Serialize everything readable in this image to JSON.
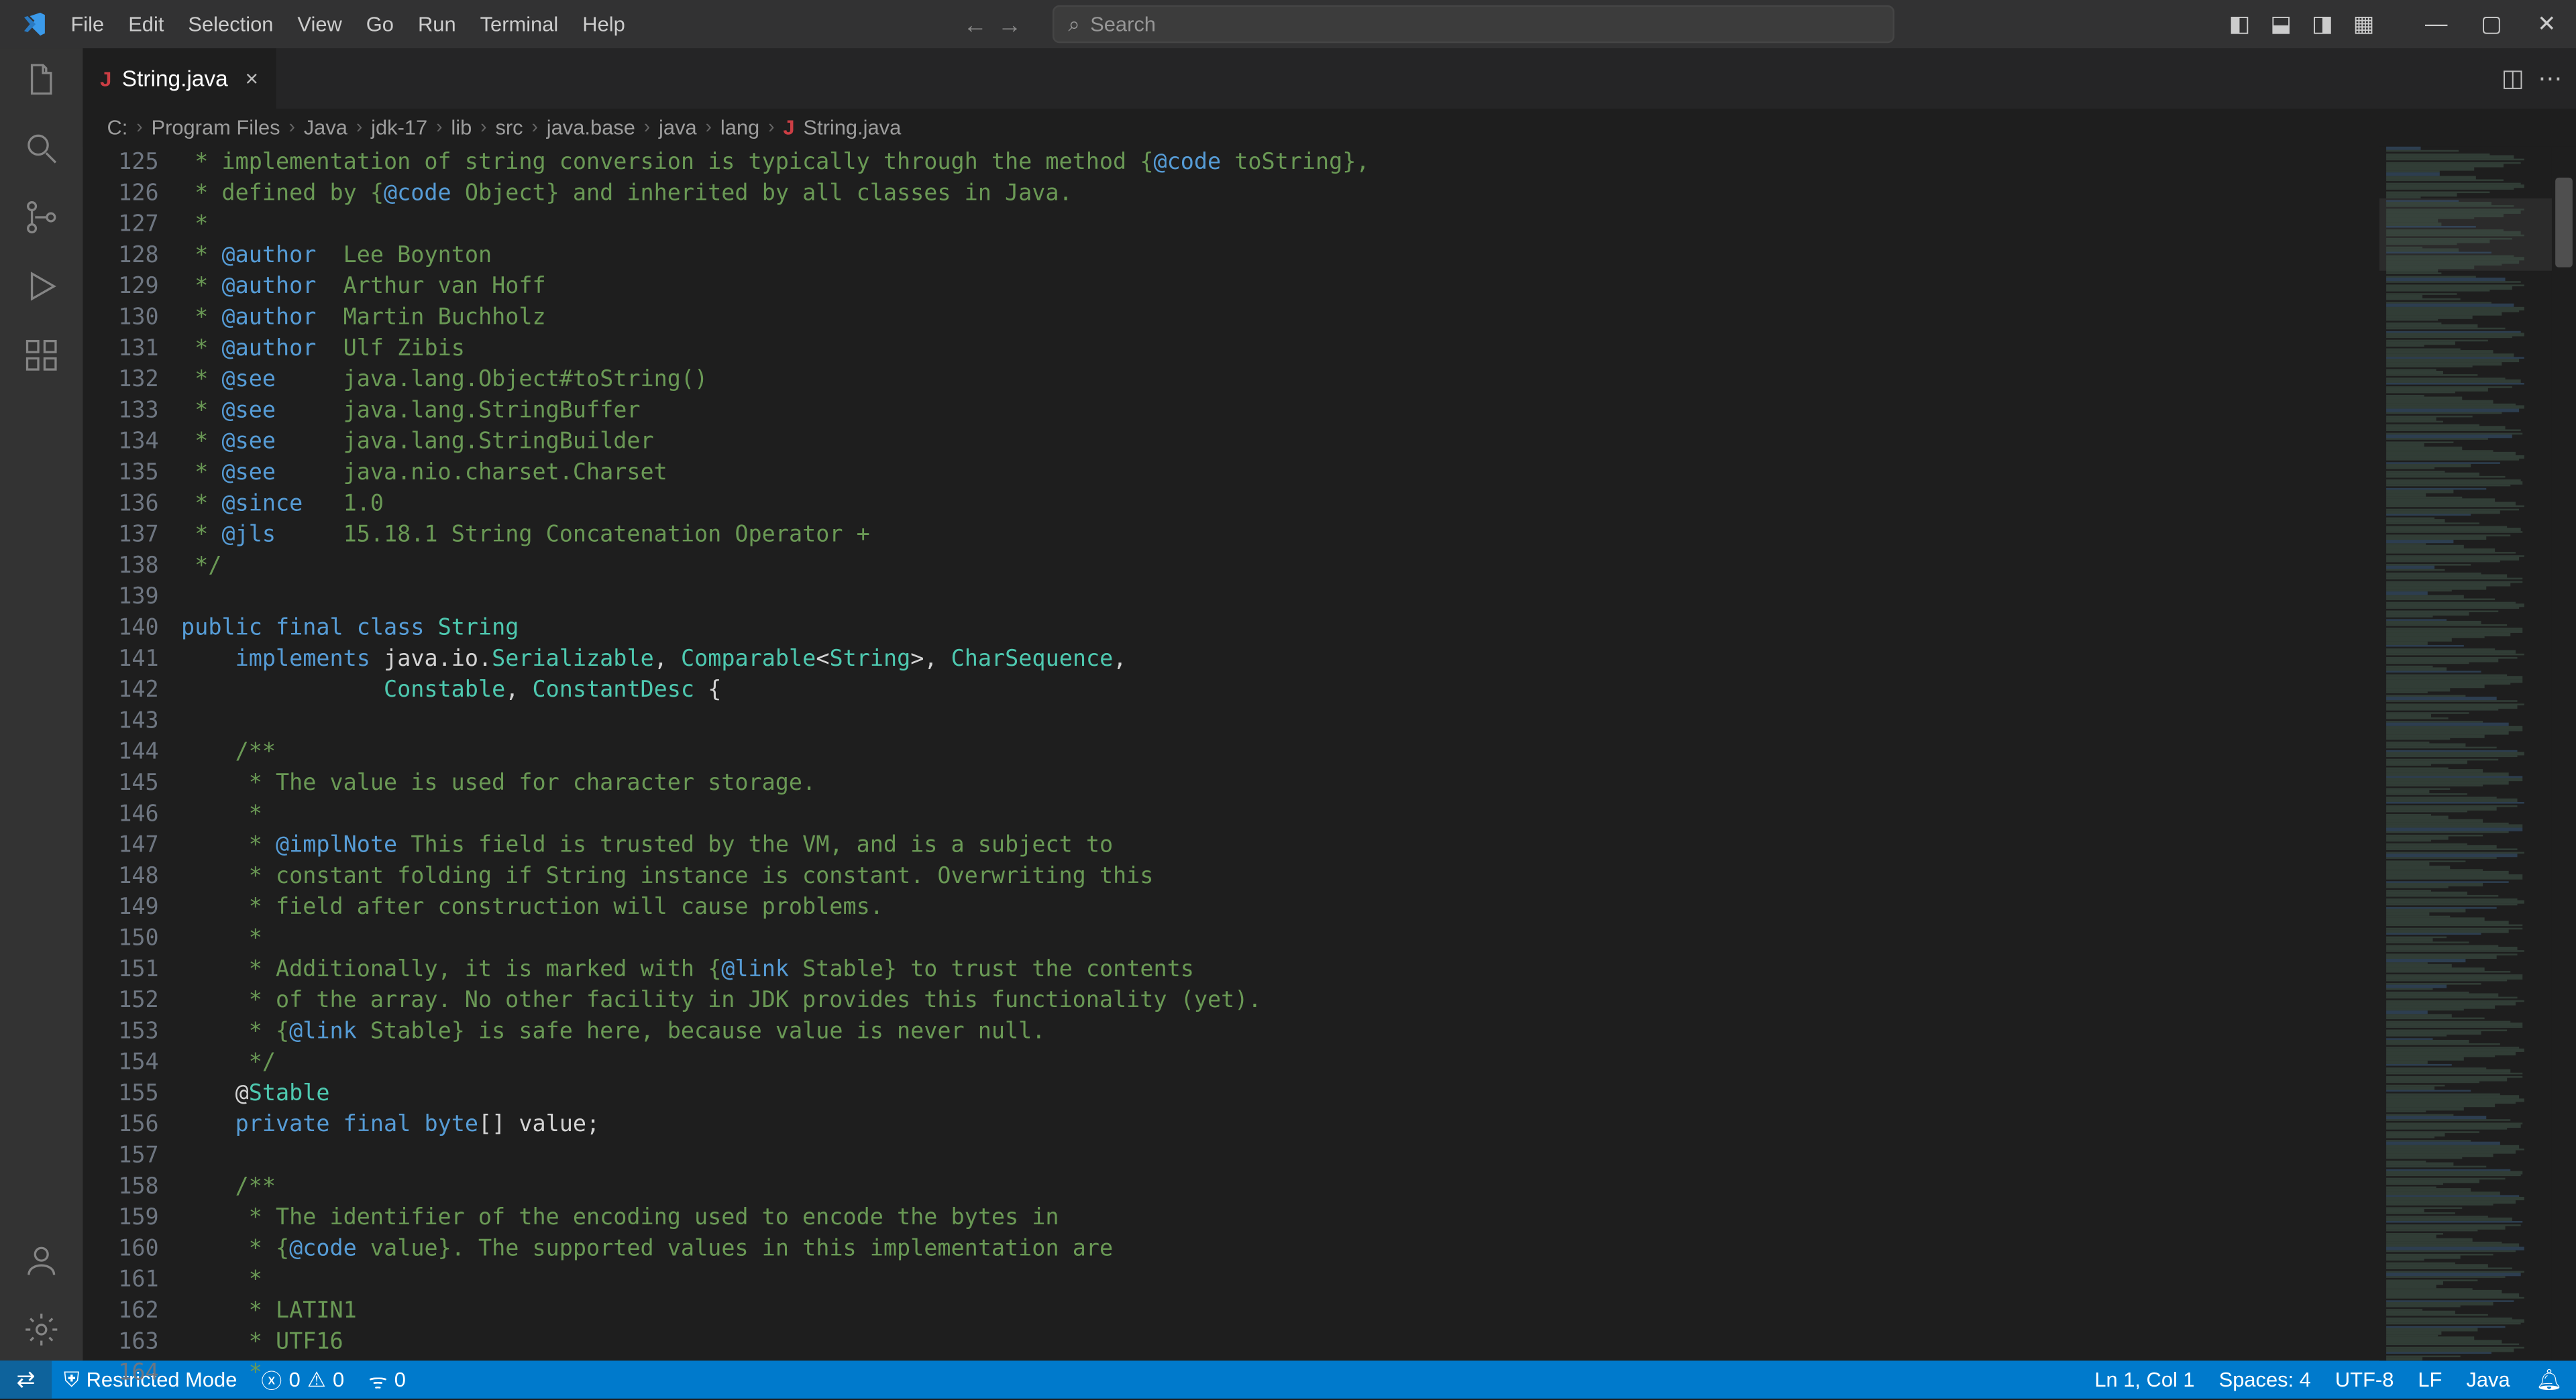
{
  "menubar": [
    "File",
    "Edit",
    "Selection",
    "View",
    "Go",
    "Run",
    "Terminal",
    "Help"
  ],
  "search_placeholder": "Search",
  "tab": {
    "name": "String.java"
  },
  "breadcrumb": [
    "C:",
    "Program Files",
    "Java",
    "jdk-17",
    "lib",
    "src",
    "java.base",
    "java",
    "lang"
  ],
  "breadcrumb_file": "String.java",
  "line_start": 125,
  "lines": [
    " * implementation of string conversion is typically through the method {@code toString},",
    " * defined by {@code Object} and inherited by all classes in Java.",
    " *",
    " * @author  Lee Boynton",
    " * @author  Arthur van Hoff",
    " * @author  Martin Buchholz",
    " * @author  Ulf Zibis",
    " * @see     java.lang.Object#toString()",
    " * @see     java.lang.StringBuffer",
    " * @see     java.lang.StringBuilder",
    " * @see     java.nio.charset.Charset",
    " * @since   1.0",
    " * @jls     15.18.1 String Concatenation Operator +",
    " */",
    "",
    "public final class String",
    "    implements java.io.Serializable, Comparable<String>, CharSequence,",
    "               Constable, ConstantDesc {",
    "",
    "    /**",
    "     * The value is used for character storage.",
    "     *",
    "     * @implNote This field is trusted by the VM, and is a subject to",
    "     * constant folding if String instance is constant. Overwriting this",
    "     * field after construction will cause problems.",
    "     *",
    "     * Additionally, it is marked with {@link Stable} to trust the contents",
    "     * of the array. No other facility in JDK provides this functionality (yet).",
    "     * {@link Stable} is safe here, because value is never null.",
    "     */",
    "    @Stable",
    "    private final byte[] value;",
    "",
    "    /**",
    "     * The identifier of the encoding used to encode the bytes in",
    "     * {@code value}. The supported values in this implementation are",
    "     *",
    "     * LATIN1",
    "     * UTF16",
    "     *"
  ],
  "status": {
    "restricted": "Restricted Mode",
    "errors": "0",
    "warnings": "0",
    "ports": "0",
    "lncol": "Ln 1, Col 1",
    "spaces": "Spaces: 4",
    "enc": "UTF-8",
    "eol": "LF",
    "lang": "Java"
  }
}
